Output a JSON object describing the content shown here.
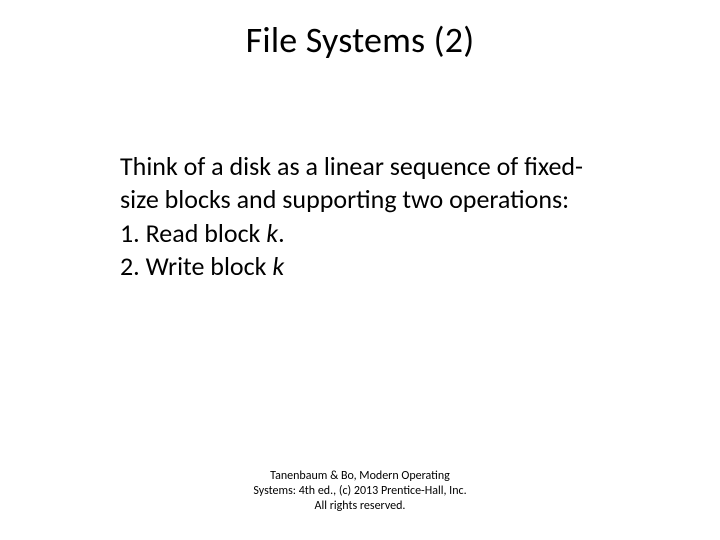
{
  "title": "File Systems (2)",
  "body": {
    "intro": "Think of a disk as a linear sequence of fixed-size blocks and supporting two operations:",
    "items": [
      {
        "num": "1.",
        "text_before": "Read block ",
        "var": "k",
        "text_after": "."
      },
      {
        "num": "2.",
        "text_before": "Write block ",
        "var": "k",
        "text_after": ""
      }
    ]
  },
  "footer": {
    "line1": "Tanenbaum & Bo, Modern Operating",
    "line2": "Systems: 4th ed., (c) 2013 Prentice-Hall, Inc.",
    "line3": "All rights reserved."
  }
}
